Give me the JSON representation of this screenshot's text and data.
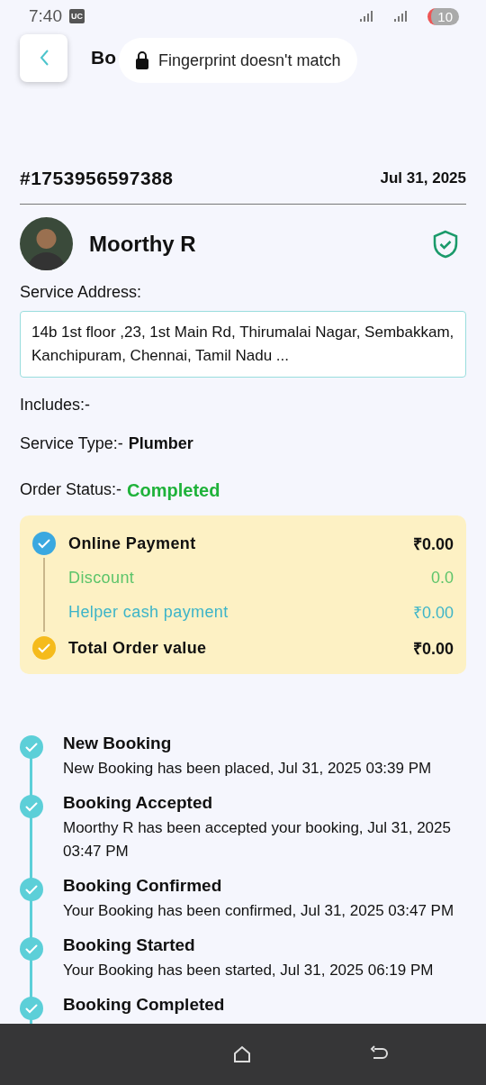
{
  "status_bar": {
    "time": "7:40",
    "badge": "UC",
    "battery": "10"
  },
  "header": {
    "title": "Bo"
  },
  "toast": {
    "text": "Fingerprint doesn't match"
  },
  "order": {
    "id": "#1753956597388",
    "date": "Jul 31, 2025"
  },
  "provider": {
    "name": "Moorthy R",
    "verified": true
  },
  "service_address": {
    "label": "Service Address:",
    "value": "14b 1st floor ,23, 1st Main Rd, Thirumalai Nagar, Sembakkam, Kanchipuram, Chennai, Tamil Nadu ..."
  },
  "includes": {
    "label": "Includes:-"
  },
  "service_type": {
    "label": "Service Type:-",
    "value": "Plumber"
  },
  "order_status": {
    "label": "Order Status:-",
    "value": "Completed"
  },
  "payment": [
    {
      "kind": "check",
      "label": "Online Payment",
      "amount": "₹0.00",
      "color": "#3aa8e0"
    },
    {
      "kind": "plain",
      "label": "Discount",
      "amount": "0.0",
      "color": "#5cc46a"
    },
    {
      "kind": "plain",
      "label": "Helper cash payment",
      "amount": "₹0.00",
      "color": "#3cb4c8"
    },
    {
      "kind": "check",
      "label": "Total Order value",
      "amount": "₹0.00",
      "color": "#f5bb1c"
    }
  ],
  "timeline": [
    {
      "title": "New Booking",
      "description": "New Booking has been placed, Jul 31, 2025 03:39 PM",
      "done": true
    },
    {
      "title": "Booking Accepted",
      "description": "Moorthy R has been accepted your booking, Jul 31, 2025 03:47 PM",
      "done": true
    },
    {
      "title": "Booking Confirmed",
      "description": "Your Booking has been confirmed, Jul 31, 2025 03:47 PM",
      "done": true
    },
    {
      "title": "Booking Started",
      "description": "Your Booking has been started, Jul 31, 2025 06:19 PM",
      "done": true
    },
    {
      "title": "Booking Completed",
      "done": true
    }
  ]
}
